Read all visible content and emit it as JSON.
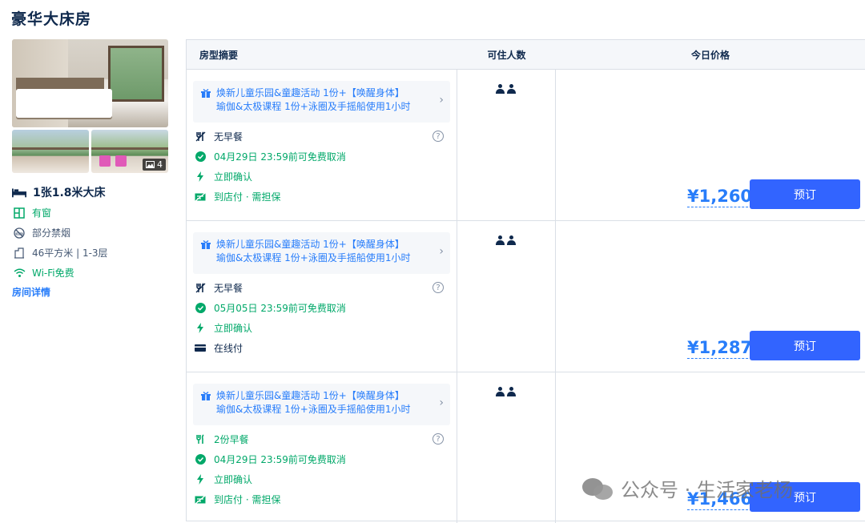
{
  "room_title": "豪华大床房",
  "gallery": {
    "photo_count": "4"
  },
  "room_info": {
    "bed": "1张1.8米大床",
    "window": "有窗",
    "smoking": "部分禁烟",
    "size_floor": "46平方米 | 1-3层",
    "wifi": "Wi-Fi免费",
    "details_link": "房间详情"
  },
  "table": {
    "headers": {
      "summary": "房型摘要",
      "occupancy": "可住人数",
      "price": "今日价格"
    },
    "rows": [
      {
        "promo_line1": "焕新儿童乐园&童趣活动 1份+【唤醒身体】",
        "promo_line2": "瑜伽&太极课程 1份+泳圈及手摇船使用1小时",
        "meal": "无早餐",
        "cancel": "04月29日 23:59前可免费取消",
        "confirm": "立即确认",
        "payment": "到店付 · 需担保",
        "price": "¥1,260",
        "book": "预订"
      },
      {
        "promo_line1": "焕新儿童乐园&童趣活动 1份+【唤醒身体】",
        "promo_line2": "瑜伽&太极课程 1份+泳圈及手摇船使用1小时",
        "meal": "无早餐",
        "cancel": "05月05日 23:59前可免费取消",
        "confirm": "立即确认",
        "payment": "在线付",
        "price": "¥1,287",
        "book": "预订"
      },
      {
        "promo_line1": "焕新儿童乐园&童趣活动 1份+【唤醒身体】",
        "promo_line2": "瑜伽&太极课程 1份+泳圈及手摇船使用1小时",
        "meal": "2份早餐",
        "cancel": "04月29日 23:59前可免费取消",
        "confirm": "立即确认",
        "payment": "到店付 · 需担保",
        "price": "¥1,466",
        "book": "预订"
      }
    ]
  },
  "watermark": "公众号 · 生活家老杨",
  "colors": {
    "accent": "#287dfa",
    "button": "#3264ff",
    "green": "#00a869",
    "text": "#0f294d"
  }
}
